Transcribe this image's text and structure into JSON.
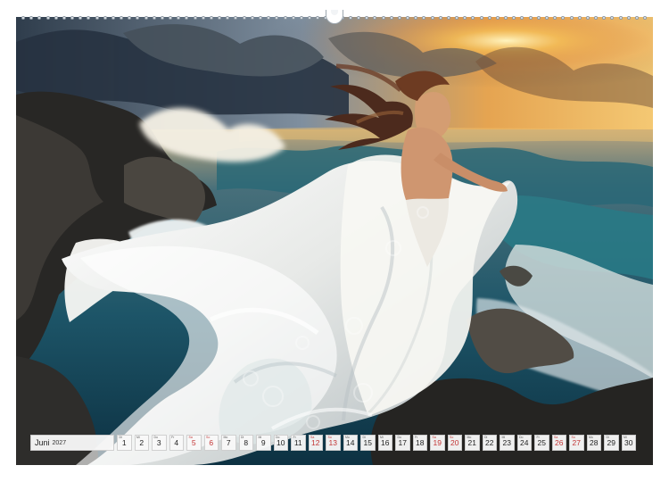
{
  "calendar": {
    "month": "Juni",
    "year": "2027",
    "weekend_color": "#c33636",
    "days": [
      {
        "weekday": "Di",
        "date": "1",
        "weekend": false
      },
      {
        "weekday": "Mi",
        "date": "2",
        "weekend": false
      },
      {
        "weekday": "Do",
        "date": "3",
        "weekend": false
      },
      {
        "weekday": "Fr",
        "date": "4",
        "weekend": false
      },
      {
        "weekday": "Sa",
        "date": "5",
        "weekend": true
      },
      {
        "weekday": "So",
        "date": "6",
        "weekend": true
      },
      {
        "weekday": "Mo",
        "date": "7",
        "weekend": false
      },
      {
        "weekday": "Di",
        "date": "8",
        "weekend": false
      },
      {
        "weekday": "Mi",
        "date": "9",
        "weekend": false
      },
      {
        "weekday": "Do",
        "date": "10",
        "weekend": false
      },
      {
        "weekday": "Fr",
        "date": "11",
        "weekend": false
      },
      {
        "weekday": "Sa",
        "date": "12",
        "weekend": true
      },
      {
        "weekday": "So",
        "date": "13",
        "weekend": true
      },
      {
        "weekday": "Mo",
        "date": "14",
        "weekend": false
      },
      {
        "weekday": "Di",
        "date": "15",
        "weekend": false
      },
      {
        "weekday": "Mi",
        "date": "16",
        "weekend": false
      },
      {
        "weekday": "Do",
        "date": "17",
        "weekend": false
      },
      {
        "weekday": "Fr",
        "date": "18",
        "weekend": false
      },
      {
        "weekday": "Sa",
        "date": "19",
        "weekend": true
      },
      {
        "weekday": "So",
        "date": "20",
        "weekend": true
      },
      {
        "weekday": "Mo",
        "date": "21",
        "weekend": false
      },
      {
        "weekday": "Di",
        "date": "22",
        "weekend": false
      },
      {
        "weekday": "Mi",
        "date": "23",
        "weekend": false
      },
      {
        "weekday": "Do",
        "date": "24",
        "weekend": false
      },
      {
        "weekday": "Fr",
        "date": "25",
        "weekend": false
      },
      {
        "weekday": "Sa",
        "date": "26",
        "weekend": true
      },
      {
        "weekday": "So",
        "date": "27",
        "weekend": true
      },
      {
        "weekday": "Mo",
        "date": "28",
        "weekend": false
      },
      {
        "weekday": "Di",
        "date": "29",
        "weekend": false
      },
      {
        "weekday": "Mi",
        "date": "30",
        "weekend": false
      }
    ]
  },
  "binding": {
    "dot_count": 77,
    "icon": "spiral-binding-icon"
  },
  "photo": {
    "palette": {
      "sky_dark": "#2f3d4c",
      "sky_mid": "#7f8f9f",
      "sunset": "#f0b24f",
      "sea": "#2f6f80",
      "sea_deep": "#113b50",
      "rock": "#2d2b29",
      "dress": "#f1f0eb",
      "hair": "#5b321f",
      "skin": "#d19a72"
    }
  }
}
